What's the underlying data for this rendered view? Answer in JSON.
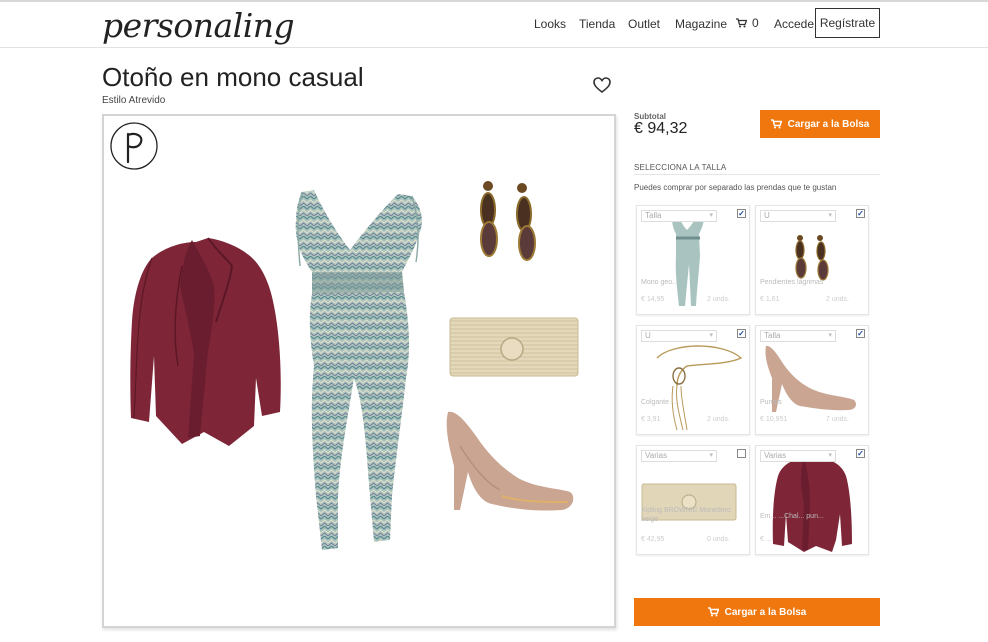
{
  "header": {
    "logo": "personaling",
    "nav": [
      "Looks",
      "Tienda",
      "Outlet",
      "Magazine"
    ],
    "cart_count": "0",
    "login": "Accede",
    "register": "Regístrate"
  },
  "look": {
    "title": "Otoño en mono casual",
    "style": "Estilo Atrevido"
  },
  "summary": {
    "subtotal_label": "Subtotal",
    "subtotal_value": "€ 94,32",
    "add_to_bag": "Cargar a la Bolsa",
    "size_heading": "SELECCIONA LA TALLA",
    "size_note": "Puedes comprar por separado las prendas que te gustan"
  },
  "products": [
    {
      "select": "Talla",
      "checked": true,
      "name": "Mono geo...",
      "price": "€ 14,95",
      "units": "2 unds."
    },
    {
      "select": "U",
      "checked": true,
      "name": "Pendientes lágrimas",
      "price": "€ 1,61",
      "units": "2 unds."
    },
    {
      "select": "U",
      "checked": true,
      "name": "Colgante ...",
      "price": "€ 3,91",
      "units": "2 unds."
    },
    {
      "select": "Talla",
      "checked": true,
      "name": "Pumps",
      "price": "€ 10,951",
      "units": "7 unds."
    },
    {
      "select": "Varias",
      "checked": false,
      "name": "Kipling BROWNIE Monedero beige",
      "price": "€ 42,95",
      "units": "0 unds."
    },
    {
      "select": "Varias",
      "checked": true,
      "name": "Em... ...Chal... pun...",
      "price": "€ ...",
      "units": ""
    }
  ],
  "colors": {
    "accent": "#f0770d",
    "cardigan": "#7e2638",
    "heels": "#c9a592",
    "clutch": "#e2d6b8"
  },
  "icons": {
    "cart": "cart-icon",
    "heart": "heart-icon",
    "checkbox": "checkmark-icon"
  }
}
